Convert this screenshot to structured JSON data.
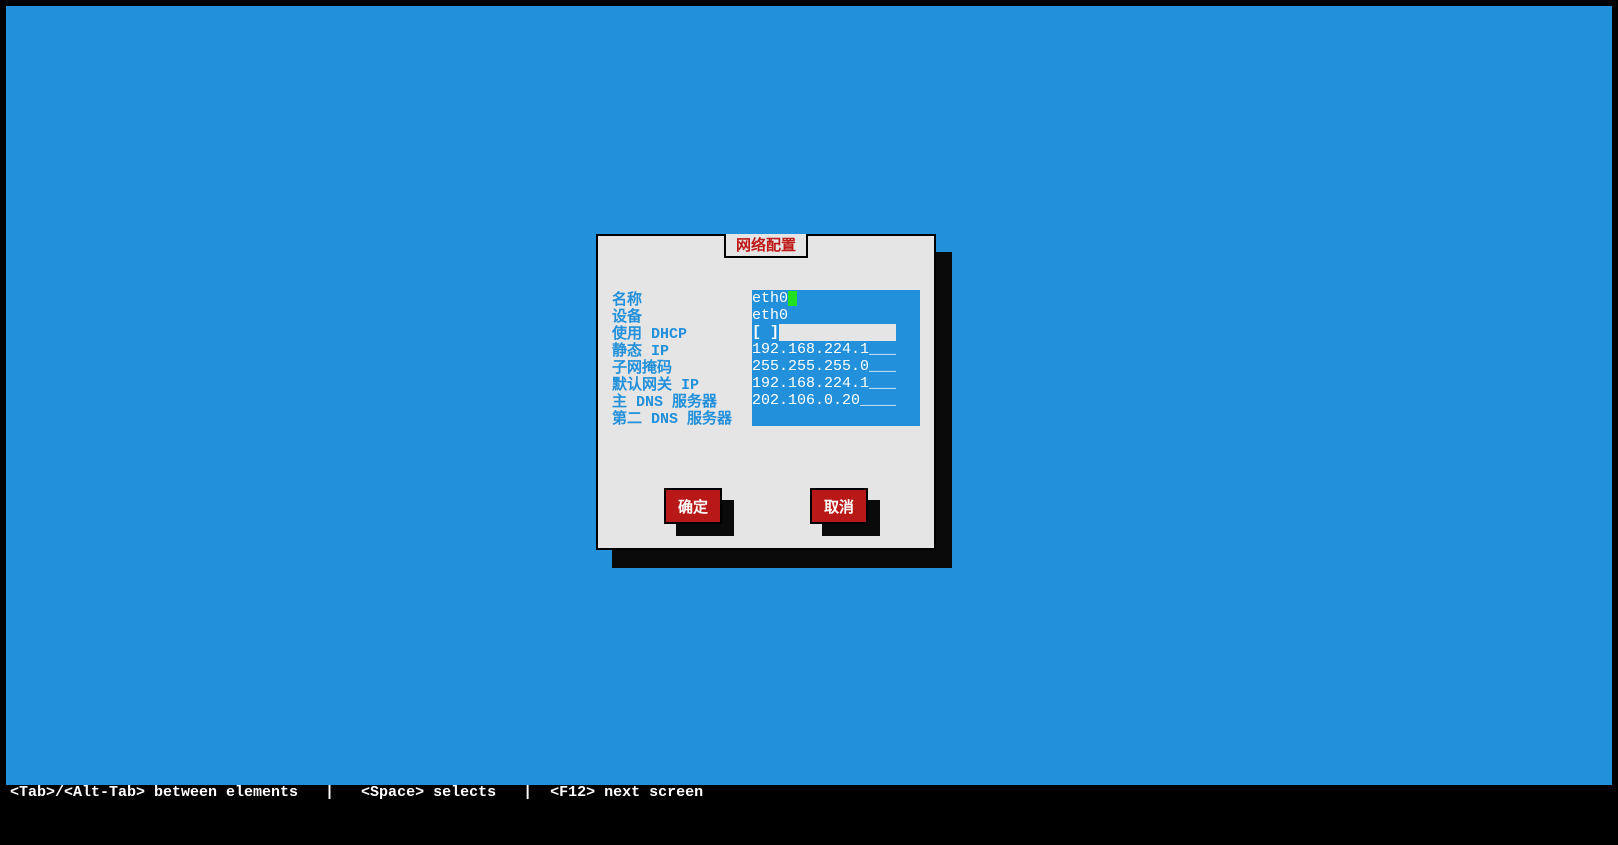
{
  "dialog": {
    "title": "网络配置",
    "fields": {
      "name": {
        "label": "名称",
        "value": "eth0"
      },
      "device": {
        "label": "设备",
        "value": "eth0"
      },
      "use_dhcp": {
        "label": "使用 DHCP",
        "value": "[ ]"
      },
      "static_ip": {
        "label": "静态 IP",
        "value": "192.168.224.1___"
      },
      "netmask": {
        "label": "子网掩码",
        "value": "255.255.255.0___"
      },
      "gateway": {
        "label": "默认网关 IP",
        "value": "192.168.224.1___"
      },
      "primary_dns": {
        "label": "主 DNS 服务器",
        "value": "202.106.0.20____"
      },
      "secondary_dns": {
        "label": "第二 DNS 服务器",
        "value": ""
      }
    },
    "buttons": {
      "ok": "确定",
      "cancel": "取消"
    }
  },
  "status_bar": "<Tab>/<Alt-Tab> between elements   |   <Space> selects   |  <F12> next screen"
}
